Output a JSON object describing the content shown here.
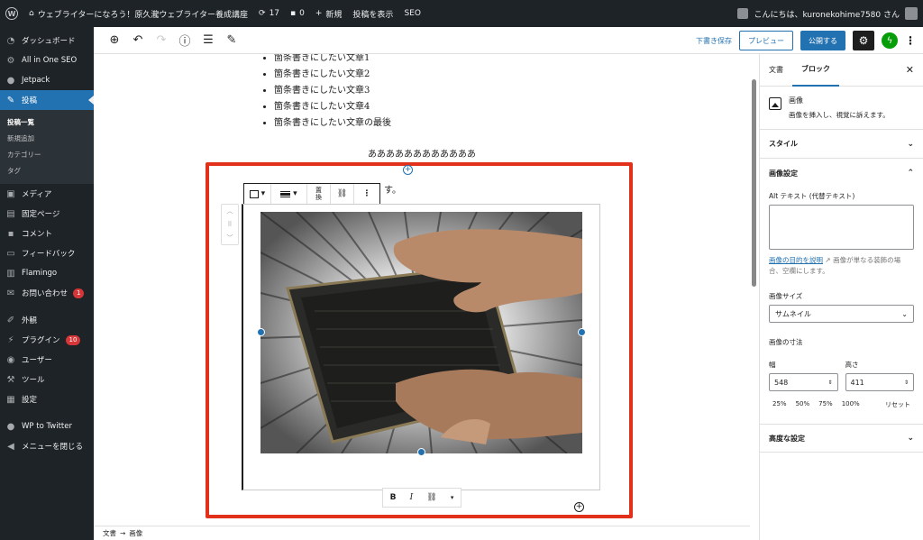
{
  "adminbar": {
    "site_name": "ウェブライターになろう！原久瀧ウェブライター養成講座",
    "updates_count": "17",
    "comments_count": "0",
    "new_label": "新規",
    "view_post": "投稿を表示",
    "seo": "SEO",
    "greeting": "こんにちは、kuronekohime7580 さん"
  },
  "sidebar": {
    "items": [
      {
        "label": "ダッシュボード",
        "icon": "dashboard-icon"
      },
      {
        "label": "All in One SEO",
        "icon": "seo-icon"
      },
      {
        "label": "Jetpack",
        "icon": "jetpack-icon"
      },
      {
        "label": "投稿",
        "icon": "pin-icon"
      },
      {
        "label": "メディア",
        "icon": "media-icon"
      },
      {
        "label": "固定ページ",
        "icon": "page-icon"
      },
      {
        "label": "コメント",
        "icon": "comment-icon"
      },
      {
        "label": "フィードバック",
        "icon": "feedback-icon"
      },
      {
        "label": "Flamingo",
        "icon": "flamingo-icon"
      },
      {
        "label": "お問い合わせ",
        "icon": "mail-icon",
        "badge": "1"
      },
      {
        "label": "外観",
        "icon": "brush-icon"
      },
      {
        "label": "プラグイン",
        "icon": "plugin-icon",
        "badge": "10"
      },
      {
        "label": "ユーザー",
        "icon": "user-icon"
      },
      {
        "label": "ツール",
        "icon": "wrench-icon"
      },
      {
        "label": "設定",
        "icon": "settings-icon"
      },
      {
        "label": "WP to Twitter",
        "icon": "twitter-icon"
      },
      {
        "label": "メニューを閉じる",
        "icon": "collapse-icon"
      }
    ],
    "submenu": [
      "投稿一覧",
      "新規追加",
      "カテゴリー",
      "タグ"
    ]
  },
  "toolbar": {
    "save_draft": "下書き保存",
    "preview": "プレビュー",
    "publish": "公開する"
  },
  "content": {
    "list_items": [
      "箇条書きにしたい文章1",
      "箇条書きにしたい文章2",
      "箇条書きにしたい文章3",
      "箇条書きにしたい文章4",
      "箇条書きにしたい文章の最後"
    ],
    "paragraph": "ああああああああああああ",
    "trailing_text": "す。",
    "replace_label_1": "置",
    "replace_label_2": "換"
  },
  "breadcrumbs": {
    "root": "文書",
    "arrow": "→",
    "current": "画像"
  },
  "panel": {
    "tab_document": "文書",
    "tab_block": "ブロック",
    "block_title": "画像",
    "block_desc": "画像を挿入し、視覚に訴えます。",
    "style_heading": "スタイル",
    "image_settings_heading": "画像設定",
    "alt_label": "Alt テキスト (代替テキスト)",
    "alt_link": "画像の目的を説明",
    "alt_help": "画像が単なる装飾の場合、空欄にします。",
    "size_label": "画像サイズ",
    "size_value": "サムネイル",
    "dimensions_label": "画像の寸法",
    "width_label": "幅",
    "height_label": "高さ",
    "width_value": "548",
    "height_value": "411",
    "presets": [
      "25%",
      "50%",
      "75%",
      "100%"
    ],
    "reset": "リセット",
    "advanced_heading": "高度な設定"
  }
}
